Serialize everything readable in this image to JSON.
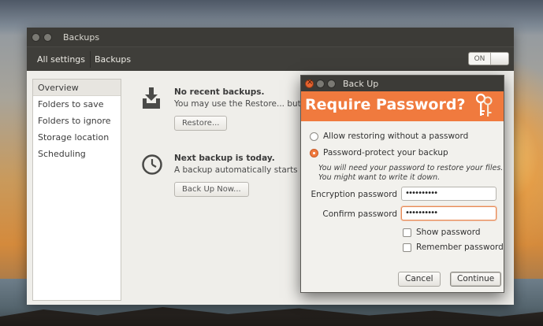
{
  "main_window": {
    "title": "Backups",
    "breadcrumbs": [
      "All settings",
      "Backups"
    ],
    "toggle_label": "ON"
  },
  "sidebar": {
    "items": [
      {
        "label": "Overview",
        "selected": true
      },
      {
        "label": "Folders to save",
        "selected": false
      },
      {
        "label": "Folders to ignore",
        "selected": false
      },
      {
        "label": "Storage location",
        "selected": false
      },
      {
        "label": "Scheduling",
        "selected": false
      }
    ]
  },
  "overview": {
    "recent": {
      "icon": "download-tray-icon",
      "title": "No recent backups.",
      "text": "You may use the Restore... button to browse for existing backups.",
      "button": "Restore..."
    },
    "next": {
      "icon": "clock-icon",
      "title": "Next backup is today.",
      "text": "A backup automatically starts every day.",
      "button": "Back Up Now..."
    }
  },
  "dialog": {
    "title": "Back Up",
    "heading": "Require Password?",
    "header_icon": "keys-icon",
    "accent_color": "#f07a3e",
    "options": [
      {
        "label": "Allow restoring without a password",
        "checked": false
      },
      {
        "label": "Password-protect your backup",
        "checked": true
      }
    ],
    "hint_line1": "You will need your password to restore your files.",
    "hint_line2": "You might want to write it down.",
    "encryption_label": "Encryption password",
    "encryption_value": "••••••••••",
    "confirm_label": "Confirm password",
    "confirm_value": "••••••••••",
    "show_password_label": "Show password",
    "remember_password_label": "Remember password",
    "cancel_label": "Cancel",
    "continue_label": "Continue"
  }
}
